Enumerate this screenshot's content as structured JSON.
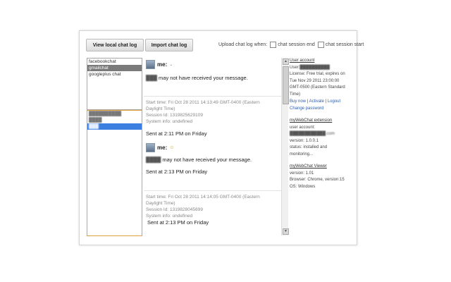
{
  "toolbar": {
    "view_log_label": "View local chat log",
    "import_log_label": "Import chat log",
    "upload_when_label": "Upload chat log when:",
    "session_end_label": "chat session end",
    "session_start_label": "chat session start"
  },
  "services": [
    "facebookchat",
    "gmailchat",
    "googleplus chat"
  ],
  "contacts": [
    "██████████",
    "████",
    "███"
  ],
  "conversation": {
    "first_sender": "me:",
    "first_message_name": "███",
    "warning_suffix": "may not have received your message.",
    "session1": {
      "start": "Start time: Fri Oct 28 2011 14:13:49 GMT-0400 (Eastern",
      "start_cont": "Daylight Time)",
      "session_id": "Session Id: 1319825629109",
      "system_info": "System info: undefined"
    },
    "sent1": "Sent at 2:11 PM on Friday",
    "second_sender": "me:",
    "second_message_name": "████",
    "sent2": "Sent at 2:13 PM on Friday",
    "session2": {
      "start": "Start time: Fri Oct 28 2011 14:14:05 GMT-0400 (Eastern",
      "start_cont": "Daylight Time)",
      "session_id": "Session Id: 1319828045699",
      "system_info": "System info: undefined"
    },
    "sent3": "Sent at 2:13 PM on Friday"
  },
  "account": {
    "heading": "User account",
    "user_label": "User:",
    "user_value": "██████████",
    "license": "License: Free trial, expires on",
    "license_date": "Tue Nov 29 2011 23:00:00",
    "license_tz": "GMT-0500 (Eastern Standard",
    "license_tz2": "Time)",
    "buy_now": "Buy now",
    "activate": "Activate",
    "logout": "Logout",
    "change_password": "Change password"
  },
  "extension": {
    "heading": "myWebChat extension",
    "user_account": "user account:",
    "email": "████████████.com",
    "version": "version: 1.0.0.1",
    "status": "status: installed and",
    "status2": "monitoring..."
  },
  "viewer": {
    "heading": "myWebChat Viewer",
    "version": "version: 1.01",
    "browser": "Browser: Chrome, version:15",
    "os": "OS: Windows"
  }
}
